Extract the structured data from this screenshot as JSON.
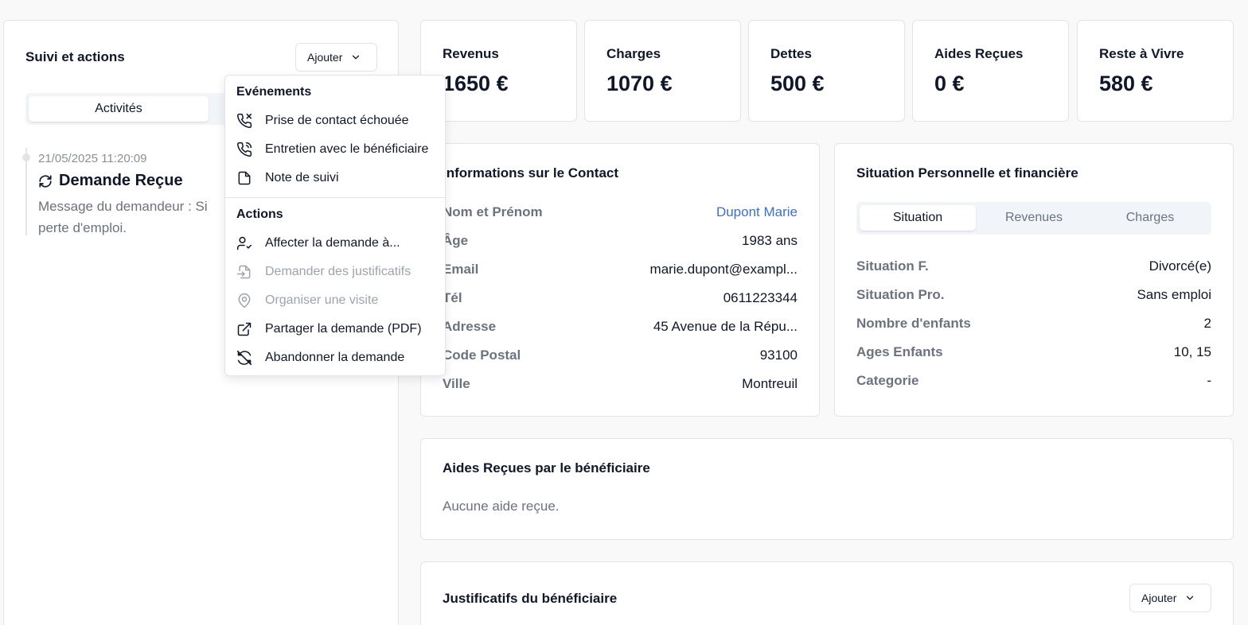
{
  "left_panel": {
    "title": "Suivi et actions",
    "add_button": "Ajouter",
    "tabs": [
      "Activités"
    ],
    "timeline": [
      {
        "date": "21/05/2025 11:20:09",
        "title": "Demande Reçue",
        "message": "Message du demandeur : Si",
        "message_line2": "perte d'emploi."
      }
    ]
  },
  "dropdown": {
    "events_heading": "Evénements",
    "events": [
      {
        "label": "Prise de contact échouée",
        "icon": "phone-missed-icon"
      },
      {
        "label": "Entretien avec le bénéficiaire",
        "icon": "phone-call-icon"
      },
      {
        "label": "Note de suivi",
        "icon": "file-icon"
      }
    ],
    "actions_heading": "Actions",
    "actions": [
      {
        "label": "Affecter la demande à...",
        "icon": "user-check-icon",
        "disabled": false
      },
      {
        "label": "Demander des justificatifs",
        "icon": "file-input-icon",
        "disabled": true
      },
      {
        "label": "Organiser une visite",
        "icon": "map-pin-icon",
        "disabled": true
      },
      {
        "label": "Partager la demande (PDF)",
        "icon": "external-link-icon",
        "disabled": false
      },
      {
        "label": "Abandonner la demande",
        "icon": "refresh-off-icon",
        "disabled": false
      }
    ]
  },
  "stats": [
    {
      "label": "Revenus",
      "value": "1650 €"
    },
    {
      "label": "Charges",
      "value": "1070 €"
    },
    {
      "label": "Dettes",
      "value": "500 €"
    },
    {
      "label": "Aides Reçues",
      "value": "0 €"
    },
    {
      "label": "Reste à Vivre",
      "value": "580 €"
    }
  ],
  "contact": {
    "title": "Informations sur le Contact",
    "rows": [
      {
        "key": "Nom et Prénom",
        "value": "Dupont Marie"
      },
      {
        "key": "Âge",
        "value": "1983 ans"
      },
      {
        "key": "Email",
        "value": "marie.dupont@exampl..."
      },
      {
        "key": "Tél",
        "value": "0611223344"
      },
      {
        "key": "Adresse",
        "value": "45 Avenue de la Répu..."
      },
      {
        "key": "Code Postal",
        "value": "93100"
      },
      {
        "key": "Ville",
        "value": "Montreuil"
      }
    ]
  },
  "situation": {
    "title": "Situation Personnelle et financière",
    "tabs": [
      "Situation",
      "Revenues",
      "Charges"
    ],
    "rows": [
      {
        "key": "Situation F.",
        "value": "Divorcé(e)"
      },
      {
        "key": "Situation Pro.",
        "value": "Sans emploi"
      },
      {
        "key": "Nombre d'enfants",
        "value": "2"
      },
      {
        "key": "Ages Enfants",
        "value": "10, 15"
      },
      {
        "key": "Categorie",
        "value": "-"
      }
    ]
  },
  "aides": {
    "title": "Aides Reçues par le bénéficiaire",
    "empty": "Aucune aide reçue."
  },
  "justificatifs": {
    "title": "Justificatifs du bénéficiaire",
    "add_button": "Ajouter"
  },
  "colors": {
    "link": "#3b6fd4",
    "muted": "#6b7280",
    "border": "#e4e4e7"
  }
}
